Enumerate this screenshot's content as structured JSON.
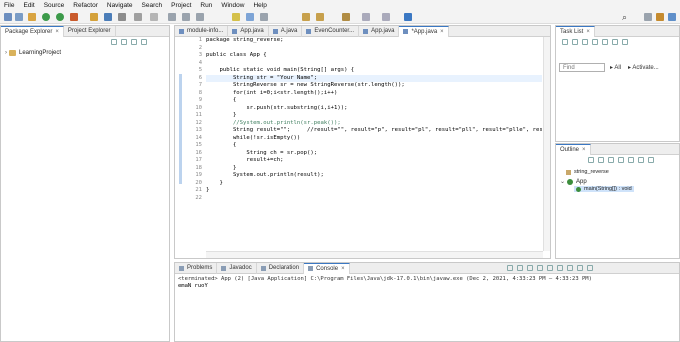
{
  "menu": [
    "File",
    "Edit",
    "Source",
    "Refactor",
    "Navigate",
    "Search",
    "Project",
    "Run",
    "Window",
    "Help"
  ],
  "left_panel": {
    "tabs": [
      {
        "label": "Package Explorer",
        "active": true
      },
      {
        "label": "Project Explorer",
        "active": false
      }
    ],
    "project": "LearningProject"
  },
  "editor": {
    "tabs": [
      {
        "label": "module-info...",
        "active": false
      },
      {
        "label": "App.java",
        "active": false
      },
      {
        "label": "A.java",
        "active": false
      },
      {
        "label": "EvenCounter...",
        "active": false
      },
      {
        "label": "App.java",
        "active": false
      },
      {
        "label": "*App.java",
        "active": true
      }
    ],
    "line_numbers": [
      "1",
      "2",
      "3",
      "4",
      "5",
      "6",
      "7",
      "8",
      "9",
      "10",
      "11",
      "12",
      "13",
      "14",
      "15",
      "16",
      "17",
      "18",
      "19",
      "20",
      "21",
      "22"
    ],
    "lines": [
      "package string_reverse;",
      "",
      "public class App {",
      "",
      "    public static void main(String[] args) {",
      "        String str = \"Your Name\";",
      "        StringReverse sr = new StringReverse(str.length());",
      "        for(int i=0;i<str.length();i++)",
      "        {",
      "            sr.push(str.substring(i,i+1));",
      "        }",
      "        //System.out.println(sr.peak());",
      "        String result=\"\";     //result=\"\", result=\"p\", result=\"pl\", result=\"pll\", result=\"plle\", result=\"pllep\"",
      "        while(!sr.isEmpty())",
      "        {",
      "            String ch = sr.pop();",
      "            result+=ch;",
      "        }",
      "        System.out.println(result);",
      "    }",
      "}",
      ""
    ]
  },
  "task_list": {
    "tab": "Task List",
    "find_placeholder": "Find",
    "all_label": "All",
    "activate_label": "Activate..."
  },
  "outline": {
    "tab": "Outline",
    "package": "string_reverse",
    "class": "App",
    "method": "main(String[]) : void"
  },
  "console": {
    "tabs": [
      {
        "label": "Problems",
        "active": false
      },
      {
        "label": "Javadoc",
        "active": false
      },
      {
        "label": "Declaration",
        "active": false
      },
      {
        "label": "Console",
        "active": true
      }
    ],
    "status": "<terminated> App (2) [Java Application] C:\\Program Files\\Java\\jdk-17.0.1\\bin\\javaw.exe  (Dec 2, 2021, 4:33:23 PM – 4:33:23 PM)",
    "output": "emaN ruoY"
  }
}
